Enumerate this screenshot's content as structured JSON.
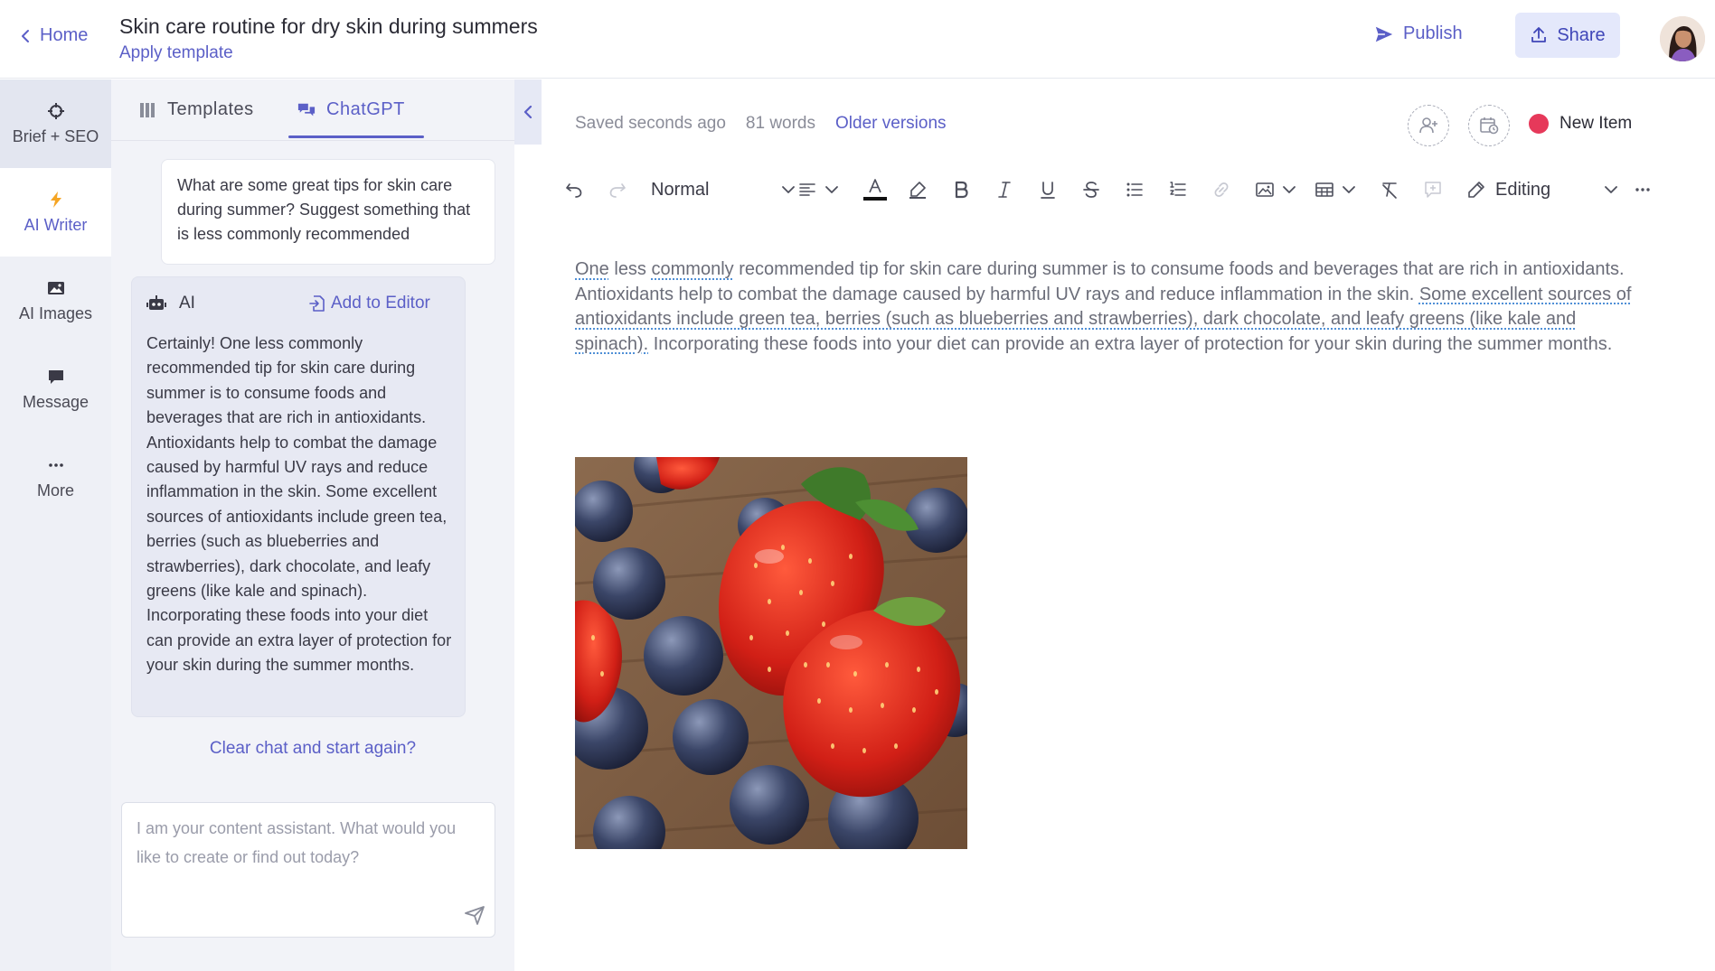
{
  "header": {
    "home_label": "Home",
    "doc_title": "Skin care routine for dry skin during summers",
    "apply_template": "Apply template",
    "publish_label": "Publish",
    "share_label": "Share"
  },
  "rail": {
    "items": [
      {
        "label": "Brief + SEO",
        "icon": "crosshair-icon"
      },
      {
        "label": "AI Writer",
        "icon": "bolt-icon"
      },
      {
        "label": "AI Images",
        "icon": "image-icon"
      },
      {
        "label": "Message",
        "icon": "message-icon"
      },
      {
        "label": "More",
        "icon": "more-icon"
      }
    ]
  },
  "panel": {
    "tabs": {
      "templates": "Templates",
      "chatgpt": "ChatGPT"
    },
    "user_message": "What are some great tips for skin care during summer? Suggest something that is less commonly recommended",
    "ai_label": "AI",
    "add_to_editor": "Add to Editor",
    "ai_message": "Certainly! One less commonly recommended tip for skin care during summer is to consume foods and beverages that are rich in antioxidants. Antioxidants help to combat the damage caused by harmful UV rays and reduce inflammation in the skin. Some excellent sources of antioxidants include green tea, berries (such as blueberries and strawberries), dark chocolate, and leafy greens (like kale and spinach). Incorporating these foods into your diet can provide an extra layer of protection for your skin during the summer months.",
    "clear_chat": "Clear chat and start again?",
    "input_placeholder": "I am your content assistant. What would you like to create or find out today?"
  },
  "editor": {
    "saved": "Saved seconds ago",
    "words": "81 words",
    "older_versions": "Older versions",
    "status_label": "New Item",
    "status_color": "#e6395a",
    "toolbar": {
      "style": "Normal",
      "mode": "Editing"
    },
    "content": {
      "p1": "One",
      "p2": " less ",
      "p3": "commonly",
      "p4": " recommended tip for skin care during summer is to consume foods and beverages that are rich in antioxidants. Antioxidants help to combat the damage caused by harmful UV rays and reduce inflammation in the skin. ",
      "p5": "Some excellent sources of antioxidants include green tea, berries (such as blueberries and strawberries), dark chocolate, and leafy greens (like kale and spinach).",
      "p6": " Incorporating these foods into your diet can provide an extra layer of protection for your skin during the summer months."
    }
  },
  "colors": {
    "accent": "#5b5fc7",
    "rail_bg": "#eef0f6",
    "share_bg": "#e4e8fb"
  }
}
